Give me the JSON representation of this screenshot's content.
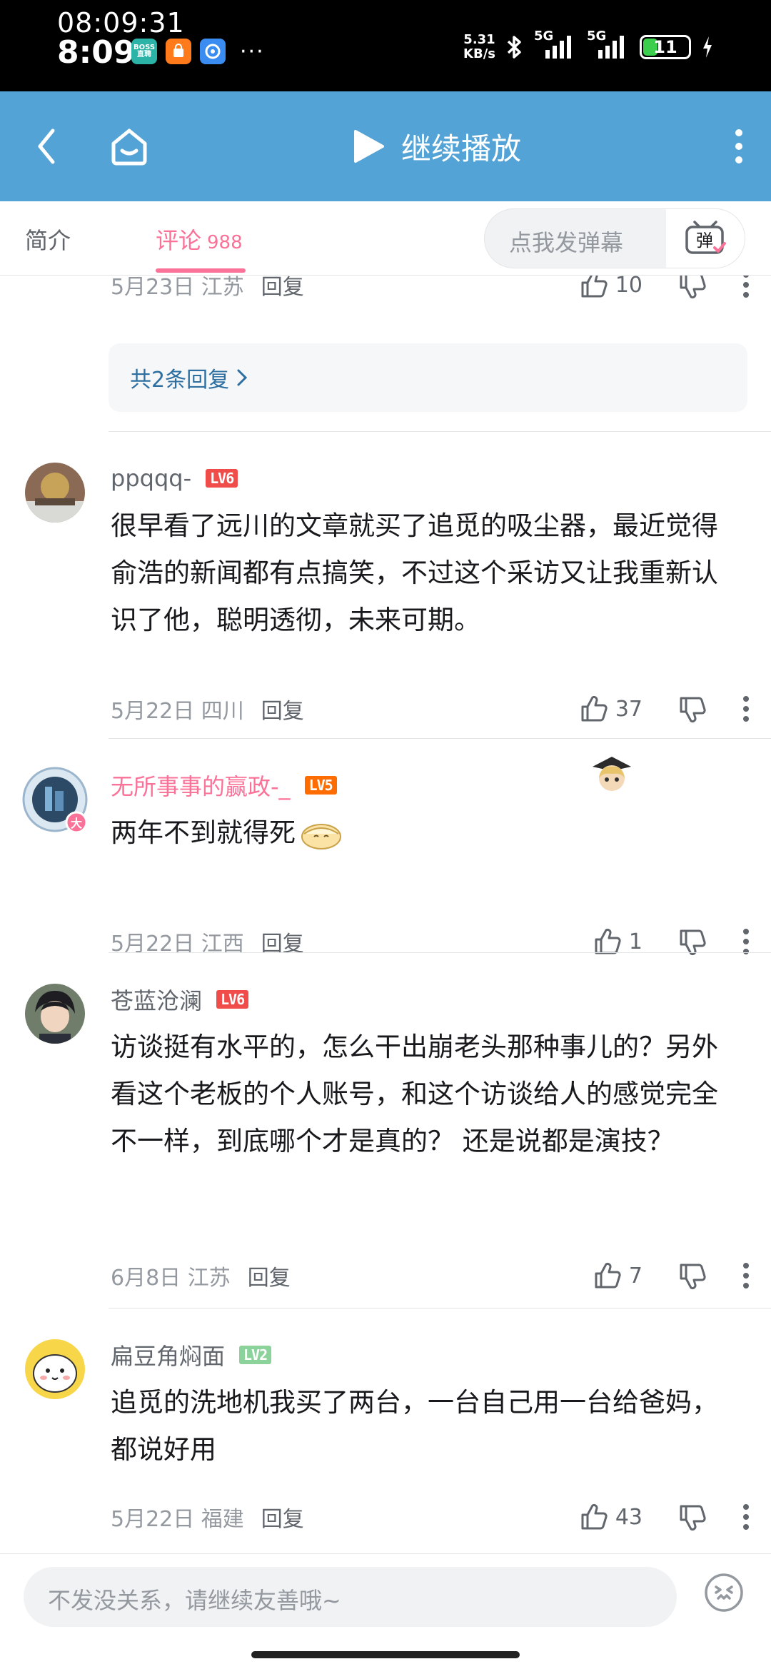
{
  "status_bar": {
    "time_seconds": "08:09:31",
    "time": "8:09",
    "app_icons": [
      {
        "name": "boss-zhipin-icon",
        "label": "BOSS直聘",
        "color": "#2ab3a6"
      },
      {
        "name": "taobao-icon",
        "label": "",
        "color": "#ff7a1a"
      },
      {
        "name": "browser-icon",
        "label": "",
        "color": "#3b8cf0"
      }
    ],
    "more_dots": "···",
    "net_speed_value": "5.31",
    "net_speed_unit": "KB/s",
    "signal_label_1": "5G",
    "signal_label_2": "5G",
    "battery": "11"
  },
  "header": {
    "title": "继续播放"
  },
  "tabs": {
    "intro": "简介",
    "comments": "评论",
    "comments_count": "988",
    "danmaku_placeholder": "点我发弹幕",
    "danmaku_button": "弹"
  },
  "top_partial": {
    "date": "5月23日 江苏",
    "reply": "回复",
    "likes": "10",
    "replies_link": "共2条回复"
  },
  "comments": [
    {
      "username": "ppqqq-",
      "level": "LV6",
      "text": "很早看了远川的文章就买了追觅的吸尘器，最近觉得俞浩的新闻都有点搞笑，不过这个采访又让我重新认识了他，聪明透彻，未来可期。",
      "date": "5月22日 四川",
      "reply": "回复",
      "likes": "37"
    },
    {
      "username": "无所事事的赢政-_",
      "level": "LV5",
      "badge": "大",
      "text": "两年不到就得死",
      "date": "5月22日 江西",
      "reply": "回复",
      "likes": "1"
    },
    {
      "username": "苍蓝沧澜",
      "level": "LV6",
      "text": "访谈挺有水平的，怎么干出崩老头那种事儿的？另外看这个老板的个人账号，和这个访谈给人的感觉完全不一样，到底哪个才是真的？ 还是说都是演技？",
      "date": "6月8日 江苏",
      "reply": "回复",
      "likes": "7"
    },
    {
      "username": "扁豆角焖面",
      "level": "LV2",
      "text": "追觅的洗地机我买了两台，一台自己用一台给爸妈，都说好用",
      "date": "5月22日 福建",
      "reply": "回复",
      "likes": "43"
    }
  ],
  "bottom": {
    "input_placeholder": "不发没关系，请继续友善哦~"
  },
  "colors": {
    "header_bg": "#54a3d6",
    "accent_pink": "#fb7299",
    "link_blue": "#2e6fa1"
  }
}
